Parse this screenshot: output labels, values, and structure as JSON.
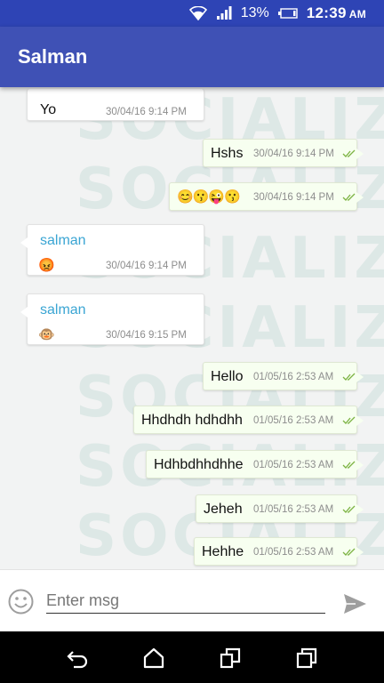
{
  "status_bar": {
    "battery_percent": "13%",
    "time": "12:39",
    "ampm": "AM"
  },
  "app_bar": {
    "title": "Salman"
  },
  "watermark": "SOCIALIZE",
  "messages": [
    {
      "direction": "in",
      "text": "Yo",
      "timestamp": "30/04/16 9:14 PM"
    },
    {
      "direction": "out",
      "text": "Hshs",
      "timestamp": "30/04/16 9:14 PM",
      "status": "delivered"
    },
    {
      "direction": "out",
      "text": "😊😗😜😗",
      "timestamp": "30/04/16 9:14 PM",
      "status": "delivered"
    },
    {
      "direction": "in",
      "sender": "salman",
      "text": "😡",
      "timestamp": "30/04/16 9:14 PM"
    },
    {
      "direction": "in",
      "sender": "salman",
      "text": "🐵",
      "timestamp": "30/04/16 9:15 PM"
    },
    {
      "direction": "out",
      "text": "Hello",
      "timestamp": "01/05/16 2:53 AM",
      "status": "delivered"
    },
    {
      "direction": "out",
      "text": "Hhdhdh hdhdhh",
      "timestamp": "01/05/16 2:53 AM",
      "status": "delivered"
    },
    {
      "direction": "out",
      "text": "Hdhbdhhdhhe",
      "timestamp": "01/05/16 2:53 AM",
      "status": "delivered"
    },
    {
      "direction": "out",
      "text": "Jeheh",
      "timestamp": "01/05/16 2:53 AM",
      "status": "delivered"
    },
    {
      "direction": "out",
      "text": "Hehhe",
      "timestamp": "01/05/16 2:53 AM",
      "status": "delivered"
    }
  ],
  "composer": {
    "placeholder": "Enter msg"
  },
  "colors": {
    "primary": "#3f51b5",
    "status_bar": "#2e44b5",
    "sender_name": "#3aa5d3",
    "read_ticks": "#7cb342",
    "outgoing_bubble": "#f7fff0"
  },
  "icons": {
    "status": [
      "wifi-icon",
      "signal-icon",
      "battery-icon"
    ],
    "composer": [
      "emoji-icon",
      "send-icon"
    ],
    "nav": [
      "back-icon",
      "home-icon",
      "screen-switch-icon",
      "recents-icon"
    ]
  }
}
